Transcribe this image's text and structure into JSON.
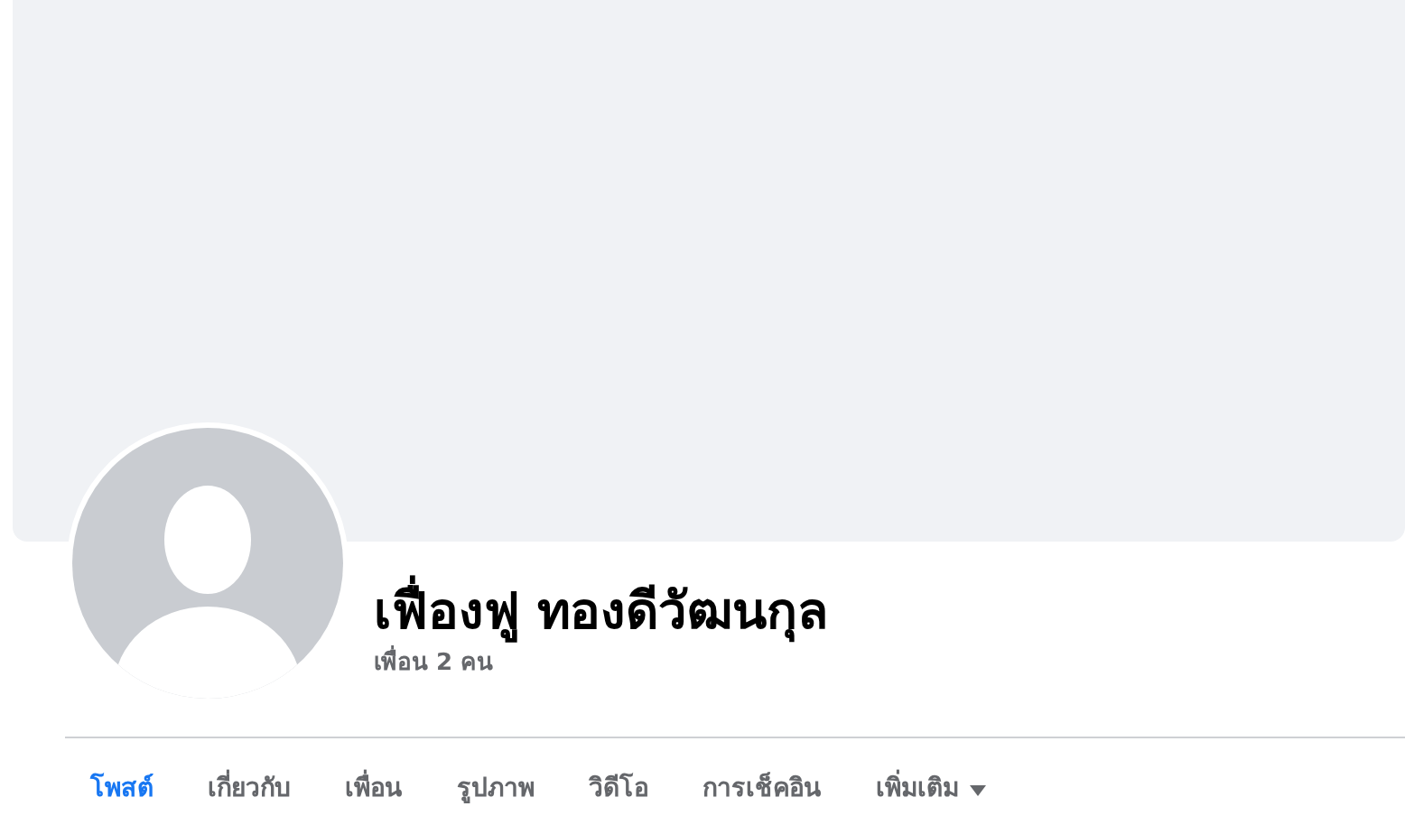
{
  "profile": {
    "name": "เฟื่องฟู ทองดีวัฒนกุล",
    "friends": "เพื่อน 2 คน"
  },
  "tabs": [
    {
      "label": "โพสต์",
      "selected": true,
      "kind": "tab"
    },
    {
      "label": "เกี่ยวกับ",
      "selected": false,
      "kind": "tab"
    },
    {
      "label": "เพื่อน",
      "selected": false,
      "kind": "tab"
    },
    {
      "label": "รูปภาพ",
      "selected": false,
      "kind": "tab"
    },
    {
      "label": "วิดีโอ",
      "selected": false,
      "kind": "tab"
    },
    {
      "label": "การเช็คอิน",
      "selected": false,
      "kind": "tab"
    },
    {
      "label": "เพิ่มเติม",
      "selected": false,
      "kind": "menu"
    }
  ]
}
